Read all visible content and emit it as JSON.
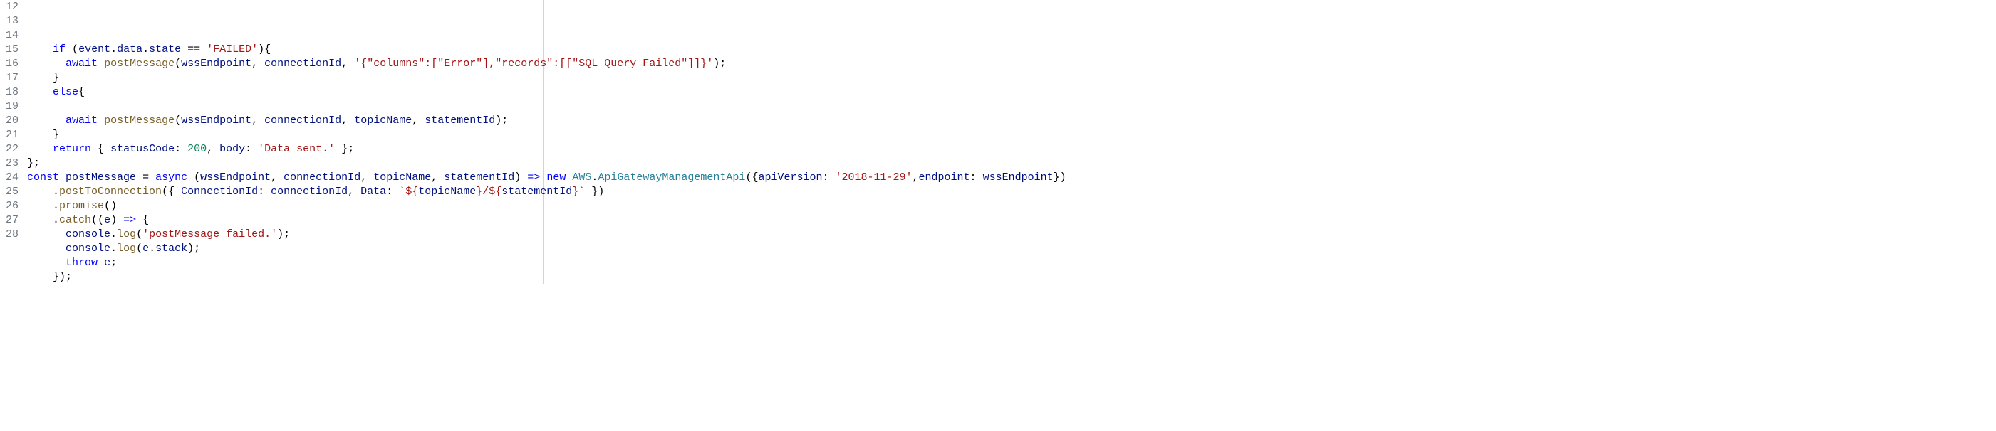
{
  "code": {
    "lines": [
      {
        "num": "12",
        "tokens": [
          {
            "t": "    ",
            "c": "plain"
          },
          {
            "t": "if",
            "c": "kw"
          },
          {
            "t": " (",
            "c": "plain"
          },
          {
            "t": "event",
            "c": "prop"
          },
          {
            "t": ".",
            "c": "plain"
          },
          {
            "t": "data",
            "c": "prop"
          },
          {
            "t": ".",
            "c": "plain"
          },
          {
            "t": "state",
            "c": "prop"
          },
          {
            "t": " == ",
            "c": "plain"
          },
          {
            "t": "'FAILED'",
            "c": "str"
          },
          {
            "t": "){",
            "c": "plain"
          }
        ]
      },
      {
        "num": "13",
        "tokens": [
          {
            "t": "      ",
            "c": "plain"
          },
          {
            "t": "await",
            "c": "kw"
          },
          {
            "t": " ",
            "c": "plain"
          },
          {
            "t": "postMessage",
            "c": "func"
          },
          {
            "t": "(",
            "c": "plain"
          },
          {
            "t": "wssEndpoint",
            "c": "prop"
          },
          {
            "t": ", ",
            "c": "plain"
          },
          {
            "t": "connectionId",
            "c": "prop"
          },
          {
            "t": ", ",
            "c": "plain"
          },
          {
            "t": "'{\"columns\":[\"Error\"],\"records\":[[\"SQL Query Failed\"]]}'",
            "c": "str"
          },
          {
            "t": ");",
            "c": "plain"
          }
        ]
      },
      {
        "num": "14",
        "tokens": [
          {
            "t": "    }",
            "c": "plain"
          }
        ]
      },
      {
        "num": "15",
        "tokens": [
          {
            "t": "    ",
            "c": "plain"
          },
          {
            "t": "else",
            "c": "kw"
          },
          {
            "t": "{",
            "c": "plain"
          }
        ]
      },
      {
        "num": "16",
        "tokens": [
          {
            "t": "",
            "c": "plain"
          }
        ]
      },
      {
        "num": "17",
        "tokens": [
          {
            "t": "      ",
            "c": "plain"
          },
          {
            "t": "await",
            "c": "kw"
          },
          {
            "t": " ",
            "c": "plain"
          },
          {
            "t": "postMessage",
            "c": "func"
          },
          {
            "t": "(",
            "c": "plain"
          },
          {
            "t": "wssEndpoint",
            "c": "prop"
          },
          {
            "t": ", ",
            "c": "plain"
          },
          {
            "t": "connectionId",
            "c": "prop"
          },
          {
            "t": ", ",
            "c": "plain"
          },
          {
            "t": "topicName",
            "c": "prop"
          },
          {
            "t": ", ",
            "c": "plain"
          },
          {
            "t": "statementId",
            "c": "prop"
          },
          {
            "t": ");",
            "c": "plain"
          }
        ]
      },
      {
        "num": "18",
        "tokens": [
          {
            "t": "    }",
            "c": "plain"
          }
        ]
      },
      {
        "num": "19",
        "tokens": [
          {
            "t": "    ",
            "c": "plain"
          },
          {
            "t": "return",
            "c": "kw"
          },
          {
            "t": " { ",
            "c": "plain"
          },
          {
            "t": "statusCode",
            "c": "prop"
          },
          {
            "t": ": ",
            "c": "plain"
          },
          {
            "t": "200",
            "c": "num"
          },
          {
            "t": ", ",
            "c": "plain"
          },
          {
            "t": "body",
            "c": "prop"
          },
          {
            "t": ": ",
            "c": "plain"
          },
          {
            "t": "'Data sent.'",
            "c": "str"
          },
          {
            "t": " };",
            "c": "plain"
          }
        ]
      },
      {
        "num": "20",
        "tokens": [
          {
            "t": "};",
            "c": "plain"
          }
        ]
      },
      {
        "num": "21",
        "tokens": [
          {
            "t": "const",
            "c": "kw"
          },
          {
            "t": " ",
            "c": "plain"
          },
          {
            "t": "postMessage",
            "c": "prop"
          },
          {
            "t": " = ",
            "c": "plain"
          },
          {
            "t": "async",
            "c": "kw"
          },
          {
            "t": " (",
            "c": "plain"
          },
          {
            "t": "wssEndpoint",
            "c": "prop"
          },
          {
            "t": ", ",
            "c": "plain"
          },
          {
            "t": "connectionId",
            "c": "prop"
          },
          {
            "t": ", ",
            "c": "plain"
          },
          {
            "t": "topicName",
            "c": "prop"
          },
          {
            "t": ", ",
            "c": "plain"
          },
          {
            "t": "statementId",
            "c": "prop"
          },
          {
            "t": ") ",
            "c": "plain"
          },
          {
            "t": "=>",
            "c": "kw"
          },
          {
            "t": " ",
            "c": "plain"
          },
          {
            "t": "new",
            "c": "kw"
          },
          {
            "t": " ",
            "c": "plain"
          },
          {
            "t": "AWS",
            "c": "type"
          },
          {
            "t": ".",
            "c": "plain"
          },
          {
            "t": "ApiGatewayManagementApi",
            "c": "type"
          },
          {
            "t": "({",
            "c": "plain"
          },
          {
            "t": "apiVersion",
            "c": "prop"
          },
          {
            "t": ": ",
            "c": "plain"
          },
          {
            "t": "'2018-11-29'",
            "c": "str"
          },
          {
            "t": ",",
            "c": "plain"
          },
          {
            "t": "endpoint",
            "c": "prop"
          },
          {
            "t": ": ",
            "c": "plain"
          },
          {
            "t": "wssEndpoint",
            "c": "prop"
          },
          {
            "t": "})",
            "c": "plain"
          }
        ]
      },
      {
        "num": "22",
        "tokens": [
          {
            "t": "    .",
            "c": "plain"
          },
          {
            "t": "postToConnection",
            "c": "func"
          },
          {
            "t": "({ ",
            "c": "plain"
          },
          {
            "t": "ConnectionId",
            "c": "prop"
          },
          {
            "t": ": ",
            "c": "plain"
          },
          {
            "t": "connectionId",
            "c": "prop"
          },
          {
            "t": ", ",
            "c": "plain"
          },
          {
            "t": "Data",
            "c": "prop"
          },
          {
            "t": ": ",
            "c": "plain"
          },
          {
            "t": "`${",
            "c": "str"
          },
          {
            "t": "topicName",
            "c": "prop"
          },
          {
            "t": "}/${",
            "c": "str"
          },
          {
            "t": "statementId",
            "c": "prop"
          },
          {
            "t": "}`",
            "c": "str"
          },
          {
            "t": " })",
            "c": "plain"
          }
        ]
      },
      {
        "num": "23",
        "tokens": [
          {
            "t": "    .",
            "c": "plain"
          },
          {
            "t": "promise",
            "c": "func"
          },
          {
            "t": "()",
            "c": "plain"
          }
        ]
      },
      {
        "num": "24",
        "tokens": [
          {
            "t": "    .",
            "c": "plain"
          },
          {
            "t": "catch",
            "c": "func"
          },
          {
            "t": "((",
            "c": "plain"
          },
          {
            "t": "e",
            "c": "prop"
          },
          {
            "t": ") ",
            "c": "plain"
          },
          {
            "t": "=>",
            "c": "kw"
          },
          {
            "t": " {",
            "c": "plain"
          }
        ]
      },
      {
        "num": "25",
        "tokens": [
          {
            "t": "      ",
            "c": "plain"
          },
          {
            "t": "console",
            "c": "prop"
          },
          {
            "t": ".",
            "c": "plain"
          },
          {
            "t": "log",
            "c": "func"
          },
          {
            "t": "(",
            "c": "plain"
          },
          {
            "t": "'postMessage failed.'",
            "c": "str"
          },
          {
            "t": ");",
            "c": "plain"
          }
        ]
      },
      {
        "num": "26",
        "tokens": [
          {
            "t": "      ",
            "c": "plain"
          },
          {
            "t": "console",
            "c": "prop"
          },
          {
            "t": ".",
            "c": "plain"
          },
          {
            "t": "log",
            "c": "func"
          },
          {
            "t": "(",
            "c": "plain"
          },
          {
            "t": "e",
            "c": "prop"
          },
          {
            "t": ".",
            "c": "plain"
          },
          {
            "t": "stack",
            "c": "prop"
          },
          {
            "t": ");",
            "c": "plain"
          }
        ]
      },
      {
        "num": "27",
        "tokens": [
          {
            "t": "      ",
            "c": "plain"
          },
          {
            "t": "throw",
            "c": "kw"
          },
          {
            "t": " ",
            "c": "plain"
          },
          {
            "t": "e",
            "c": "prop"
          },
          {
            "t": ";",
            "c": "plain"
          }
        ]
      },
      {
        "num": "28",
        "tokens": [
          {
            "t": "    });",
            "c": "plain"
          }
        ]
      }
    ]
  }
}
